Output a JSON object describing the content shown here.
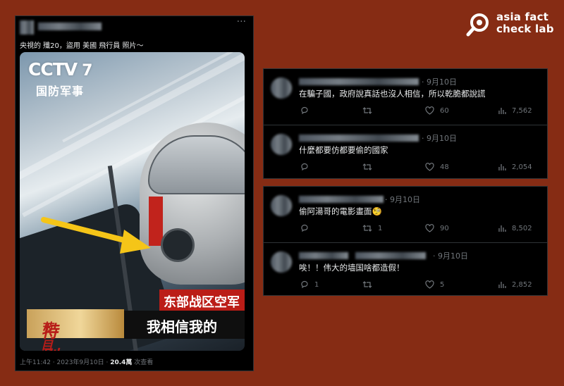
{
  "brand": {
    "line1": "asia fact",
    "line2": "check lab",
    "color": "#ffffff"
  },
  "tweet": {
    "more_label": "···",
    "caption": "央視的 殲20，盜用 美國 飛行員 照片～",
    "media": {
      "logo_cctv": "CCTV",
      "logo_num": "7",
      "logo_sub": "国防军事",
      "banner_top": "东部战区空军",
      "banner_tag_a": "特别",
      "banner_tag_b": "节目",
      "banner_bottom": "我相信我的",
      "arrow_color": "#f5c518"
    },
    "meta_time": "上午11:42 · 2023年9月10日 · ",
    "meta_views": "20.4萬",
    "meta_views_label": " 次查看"
  },
  "panel1": {
    "replies": [
      {
        "date": "· 9月10日",
        "text": "在騙子國，政府說真話也沒人相信，所以乾脆都說謊",
        "replies": "",
        "likes": "60",
        "views": "7,562"
      },
      {
        "date": "· 9月10日",
        "text": "什麼都要仿都要偷的國家",
        "replies": "",
        "likes": "48",
        "views": "2,054"
      }
    ]
  },
  "panel2": {
    "replies": [
      {
        "date": "· 9月10日",
        "text": "偷阿湯哥的電影畫面",
        "emoji": "🧐",
        "reposts": "1",
        "likes": "90",
        "views": "8,502"
      },
      {
        "date": "· 9月10日",
        "text": "唉！！伟大的墙国啥都造假！",
        "replies": "1",
        "likes": "5",
        "views": "2,852"
      }
    ]
  },
  "colors": {
    "background": "#862c14",
    "panel": "#000000",
    "muted": "#71767b",
    "text": "#e7e9ea"
  }
}
